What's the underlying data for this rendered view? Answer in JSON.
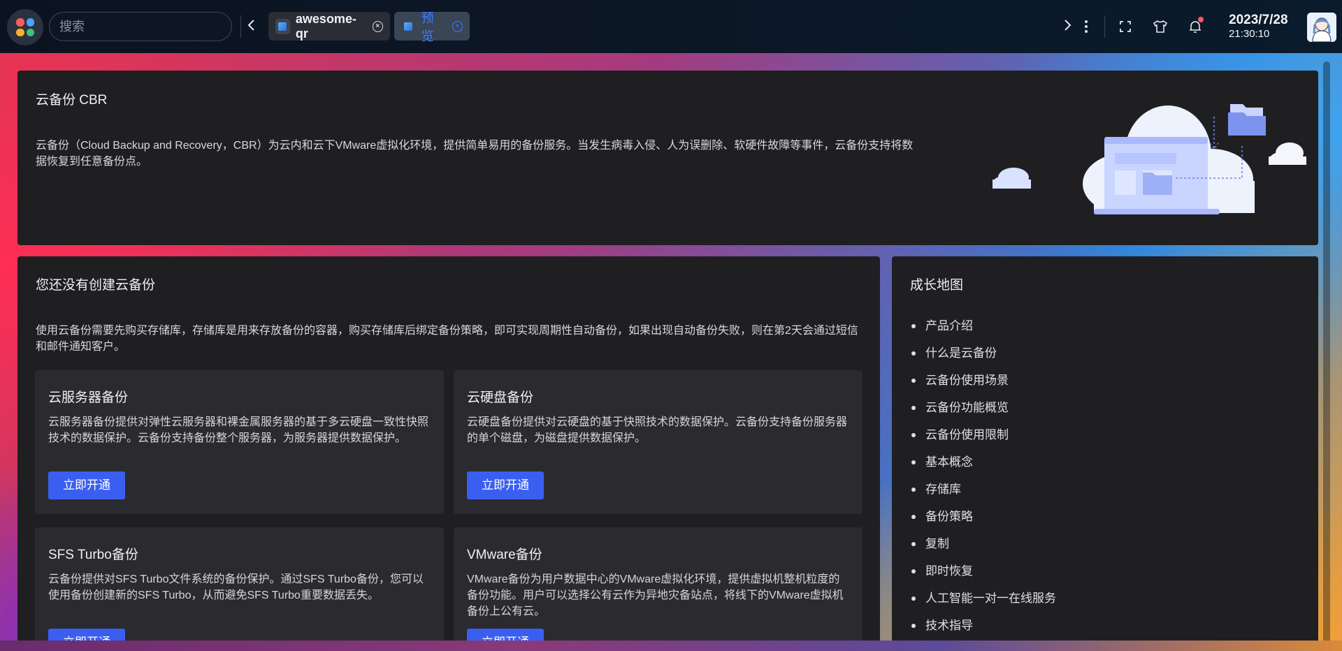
{
  "topbar": {
    "search_placeholder": "搜索",
    "tabs": [
      {
        "label": "awesome-qr"
      },
      {
        "label": "预览"
      }
    ],
    "date": "2023/7/28",
    "time": "21:30:10"
  },
  "hero": {
    "title": "云备份 CBR",
    "description": "云备份（Cloud Backup and Recovery，CBR）为云内和云下VMware虚拟化环境，提供简单易用的备份服务。当发生病毒入侵、人为误删除、软硬件故障等事件，云备份支持将数据恢复到任意备份点。"
  },
  "main": {
    "title": "您还没有创建云备份",
    "description": "使用云备份需要先购买存储库，存储库是用来存放备份的容器，购买存储库后绑定备份策略，即可实现周期性自动备份，如果出现自动备份失败，则在第2天会通过短信和邮件通知客户。",
    "cards": [
      {
        "title": "云服务器备份",
        "description": "云服务器备份提供对弹性云服务器和裸金属服务器的基于多云硬盘一致性快照技术的数据保护。云备份支持备份整个服务器，为服务器提供数据保护。",
        "button": "立即开通"
      },
      {
        "title": "云硬盘备份",
        "description": "云硬盘备份提供对云硬盘的基于快照技术的数据保护。云备份支持备份服务器的单个磁盘，为磁盘提供数据保护。",
        "button": "立即开通"
      },
      {
        "title": "SFS Turbo备份",
        "description": "云备份提供对SFS Turbo文件系统的备份保护。通过SFS Turbo备份，您可以使用备份创建新的SFS Turbo，从而避免SFS Turbo重要数据丢失。",
        "button": "立即开通"
      },
      {
        "title": "VMware备份",
        "description": "VMware备份为用户数据中心的VMware虚拟化环境，提供虚拟机整机粒度的备份功能。用户可以选择公有云作为异地灾备站点，将线下的VMware虚拟机备份上公有云。",
        "button": "立即开通"
      }
    ]
  },
  "side": {
    "title": "成长地图",
    "items": [
      "产品介绍",
      "什么是云备份",
      "云备份使用场景",
      "云备份功能概览",
      "云备份使用限制",
      "基本概念",
      "存储库",
      "备份策略",
      "复制",
      "即时恢复",
      "人工智能一对一在线服务",
      "技术指导"
    ]
  },
  "icons": {
    "launcher": "app-launcher-icon",
    "back": "chevron-left-icon",
    "forward": "chevron-right-icon",
    "more": "more-vertical-icon",
    "fullscreen": "fullscreen-icon",
    "theme": "shirt-icon",
    "notifications": "bell-icon"
  },
  "colors": {
    "accent": "#3a5ff0",
    "active_tab_text": "#3d7dff",
    "notification_dot": "#ff5a5a"
  }
}
